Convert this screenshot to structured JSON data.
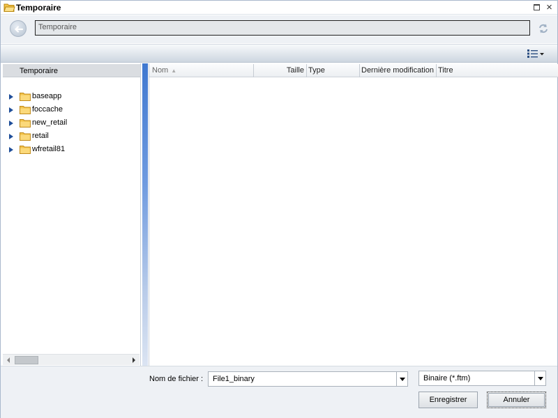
{
  "window": {
    "title": "Temporaire",
    "icon": "folder-open-icon",
    "maximize_icon": "maximize-icon",
    "close_icon": "close-icon",
    "close_glyph": "×"
  },
  "addressbar": {
    "back_icon": "back-arrow-icon",
    "path": "Temporaire",
    "refresh_icon": "refresh-icon"
  },
  "toolbar": {
    "view_icon": "details-view-icon"
  },
  "left_pane": {
    "header": "Temporaire",
    "tree": [
      {
        "label": "baseapp"
      },
      {
        "label": "foccache"
      },
      {
        "label": "new_retail"
      },
      {
        "label": "retail"
      },
      {
        "label": "wfretail81"
      }
    ]
  },
  "file_list": {
    "columns": {
      "name": "Nom",
      "size": "Taille",
      "type": "Type",
      "modified": "Dernière modification",
      "title": "Titre"
    },
    "sort_glyph": "▲",
    "rows": []
  },
  "footer": {
    "filename_label": "Nom de fichier :",
    "filename_value": "File1_binary",
    "filetype_value": "Binaire (*.ftm)",
    "save_label": "Enregistrer",
    "cancel_label": "Annuler"
  },
  "colors": {
    "splitter": "#3f78d0",
    "tree_arrow": "#1f4e99",
    "folder": "#f2c24a"
  }
}
